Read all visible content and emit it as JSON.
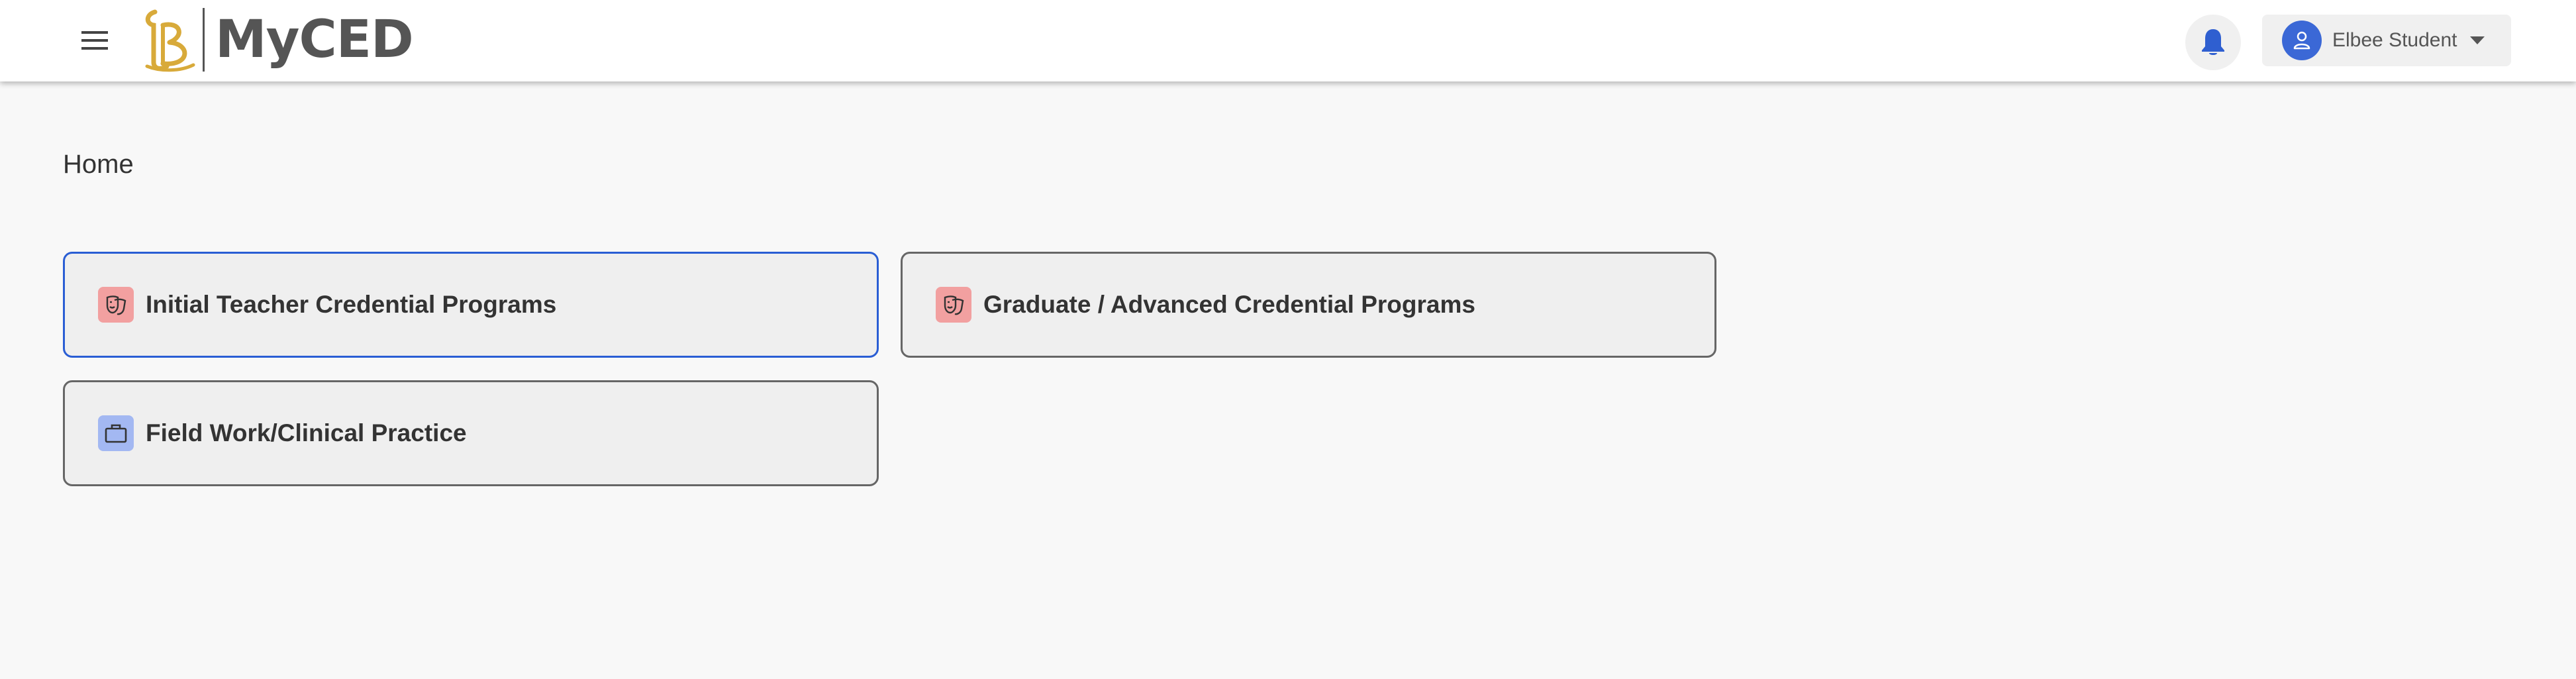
{
  "header": {
    "brand_title": "MyCED",
    "logo_letters": "LB",
    "menu_icon": "hamburger-menu-icon",
    "notifications_icon": "bell-icon",
    "user": {
      "name": "Elbee Student",
      "avatar_icon": "person-icon",
      "caret_icon": "caret-down-icon"
    }
  },
  "breadcrumb": {
    "current": "Home"
  },
  "cards": [
    {
      "label": "Initial Teacher Credential Programs",
      "icon": "theater-masks-icon",
      "icon_bg": "#f2a0a0",
      "focused": true
    },
    {
      "label": "Graduate / Advanced Credential Programs",
      "icon": "theater-masks-icon",
      "icon_bg": "#f2a0a0",
      "focused": false
    },
    {
      "label": "Field Work/Clinical Practice",
      "icon": "briefcase-icon",
      "icon_bg": "#a3b8f2",
      "focused": false
    }
  ],
  "colors": {
    "accent_blue": "#3b68d6",
    "focus_border": "#2a5ed4",
    "logo_gold": "#d8aa3a",
    "card_border": "#666666",
    "background": "#f8f8f8"
  }
}
